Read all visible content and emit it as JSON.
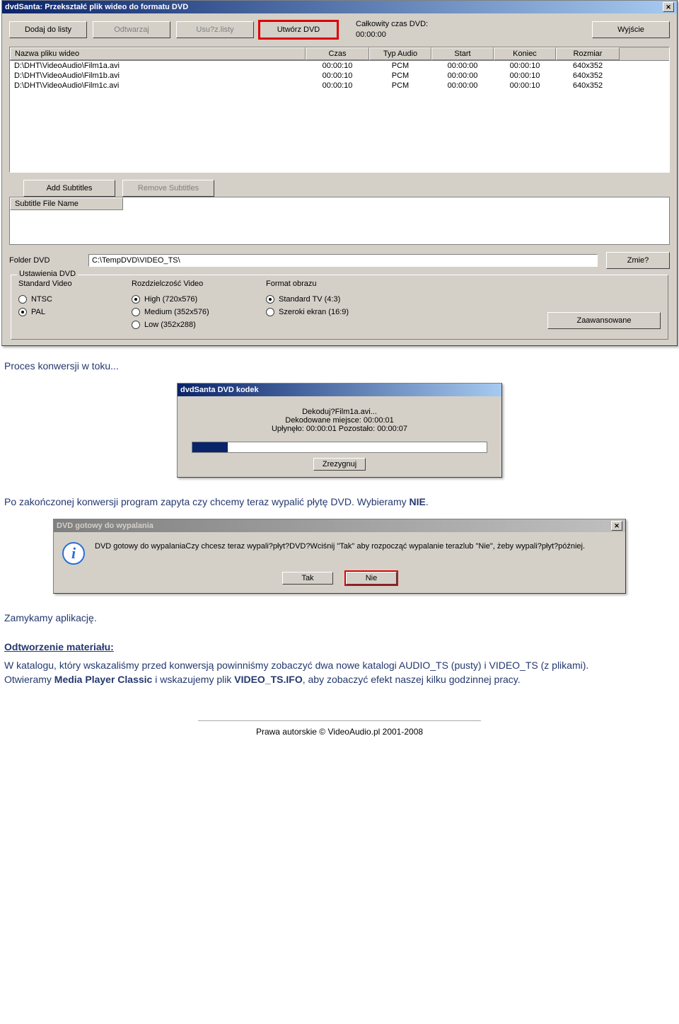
{
  "main_window": {
    "title": "dvdSanta: Przekształć plik wideo do formatu DVD",
    "toolbar": {
      "add": "Dodaj do listy",
      "play": "Odtwarzaj",
      "remove": "Usu?z.listy",
      "create": "Utwórz DVD",
      "exit": "Wyjście"
    },
    "dvd_time_label": "Całkowity czas DVD:",
    "dvd_time_value": "00:00:00",
    "columns": {
      "name": "Nazwa pliku wideo",
      "time": "Czas",
      "audio": "Typ Audio",
      "start": "Start",
      "end": "Koniec",
      "size": "Rozmiar"
    },
    "rows": [
      {
        "name": "D:\\DHT\\VideoAudio\\Film1a.avi",
        "time": "00:00:10",
        "audio": "PCM",
        "start": "00:00:00",
        "end": "00:00:10",
        "size": "640x352"
      },
      {
        "name": "D:\\DHT\\VideoAudio\\Film1b.avi",
        "time": "00:00:10",
        "audio": "PCM",
        "start": "00:00:00",
        "end": "00:00:10",
        "size": "640x352"
      },
      {
        "name": "D:\\DHT\\VideoAudio\\Film1c.avi",
        "time": "00:00:10",
        "audio": "PCM",
        "start": "00:00:00",
        "end": "00:00:10",
        "size": "640x352"
      }
    ],
    "subtitles": {
      "add": "Add Subtitles",
      "remove": "Remove Subtitles",
      "col": "Subtitle File Name"
    },
    "folder_label": "Folder DVD",
    "folder_value": "C:\\TempDVD\\VIDEO_TS\\",
    "change_btn": "Zmie?",
    "settings_legend": "Ustawienia DVD",
    "standard_label": "Standard Video",
    "ntsc": "NTSC",
    "pal": "PAL",
    "res_label": "Rozdzielczość Video",
    "res_high": "High (720x576)",
    "res_med": "Medium (352x576)",
    "res_low": "Low (352x288)",
    "fmt_label": "Format obrazu",
    "fmt_std": "Standard TV (4:3)",
    "fmt_wide": "Szeroki ekran (16:9)",
    "advanced": "Zaawansowane"
  },
  "doc": {
    "p1": "Proces konwersji w toku...",
    "p2_a": "Po zakończonej konwersji program zapyta czy chcemy teraz wypalić płytę DVD. Wybieramy ",
    "p2_b": "NIE",
    "p2_c": ".",
    "p3": "Zamykamy aplikację.",
    "h1": "Odtworzenie materiału:",
    "p4_a": "W katalogu, który wskazaliśmy przed konwersją powinniśmy zobaczyć dwa nowe katalogi AUDIO_TS (pusty) i VIDEO_TS (z plikami).",
    "p4_b1": "Otwieramy ",
    "p4_b2": "Media Player Classic",
    "p4_b3": " i wskazujemy plik ",
    "p4_b4": "VIDEO_TS.IFO",
    "p4_b5": ", aby zobaczyć efekt naszej kilku godzinnej pracy.",
    "footer": "Prawa autorskie © VideoAudio.pl 2001-2008"
  },
  "codec": {
    "title": "dvdSanta DVD kodek",
    "line1": "Dekoduj?Film1a.avi...",
    "line2": "Dekodowane miejsce: 00:00:01",
    "line3": "Upłynęło: 00:00:01 Pozostało: 00:00:07",
    "cancel": "Zrezygnuj"
  },
  "msgbox": {
    "title": "DVD gotowy do wypalania",
    "text": "DVD gotowy do wypalaniaCzy chcesz teraz wypali?płyt?DVD?Wciśnij \"Tak\" aby rozpocząć wypalanie terazlub \"Nie\", żeby wypali?płyt?później.",
    "yes": "Tak",
    "no": "Nie"
  }
}
